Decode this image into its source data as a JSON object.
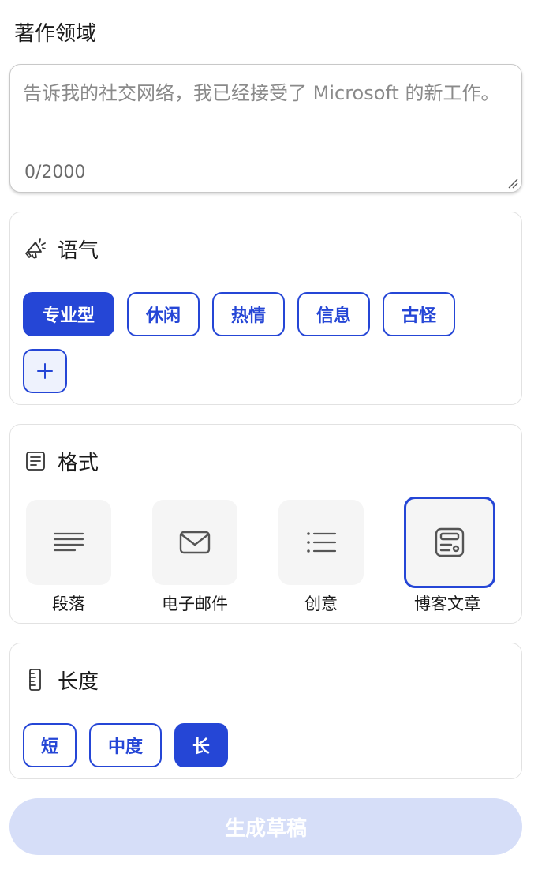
{
  "page_title": "著作领域",
  "prompt": {
    "placeholder": "告诉我的社交网络，我已经接受了 Microsoft 的新工作。",
    "value": "",
    "char_count": "0/2000"
  },
  "tone": {
    "title": "语气",
    "icon": "megaphone-icon",
    "options": [
      {
        "label": "专业型",
        "selected": true
      },
      {
        "label": "休闲",
        "selected": false
      },
      {
        "label": "热情",
        "selected": false
      },
      {
        "label": "信息",
        "selected": false
      },
      {
        "label": "古怪",
        "selected": false
      }
    ],
    "add_label": "+"
  },
  "format": {
    "title": "格式",
    "icon": "document-lines-icon",
    "options": [
      {
        "label": "段落",
        "icon": "paragraph-icon",
        "selected": false
      },
      {
        "label": "电子邮件",
        "icon": "mail-icon",
        "selected": false
      },
      {
        "label": "创意",
        "icon": "list-icon",
        "selected": false
      },
      {
        "label": "博客文章",
        "icon": "blog-post-icon",
        "selected": true
      }
    ]
  },
  "length": {
    "title": "长度",
    "icon": "ruler-icon",
    "options": [
      {
        "label": "短",
        "selected": false
      },
      {
        "label": "中度",
        "selected": false
      },
      {
        "label": "长",
        "selected": true
      }
    ]
  },
  "generate_button": {
    "label": "生成草稿",
    "enabled": false
  },
  "colors": {
    "accent": "#2546d6",
    "tile_bg": "#f5f5f5",
    "disabled_button": "#d6def8"
  }
}
